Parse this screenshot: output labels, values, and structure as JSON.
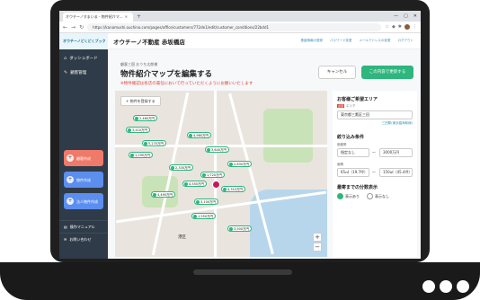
{
  "browser": {
    "tab_title": "オウチーノすまいる - 物件紹介マ...",
    "new_tab": "+",
    "url": "https://kanamushi.ouchino.com/pages/office/customers/772de1/edit/customer_conditions/22bdd1",
    "window_controls": [
      "—",
      "▢",
      "✕"
    ]
  },
  "sidebar": {
    "logo": "オウチーノどくどくブック",
    "items": [
      {
        "label": "ダッシュボード",
        "icon": "home-icon"
      },
      {
        "label": "顧客管理",
        "icon": "wrench-icon"
      }
    ],
    "buttons": [
      {
        "label": "顧客作成",
        "color": "#f07a6a"
      },
      {
        "label": "物件作成",
        "color": "#5c8ef0"
      },
      {
        "label": "法人物件作成",
        "color": "#5c8ef0"
      }
    ],
    "bottom_items": [
      {
        "label": "操作マニュアル"
      },
      {
        "label": "お問い合わせ"
      }
    ]
  },
  "header": {
    "company": "オウチーノ不動産 赤坂橋店",
    "links": [
      "基盤情報の登録",
      "パスワード変更",
      "メールアドレスの変更",
      "ログアウト"
    ]
  },
  "page": {
    "breadcrumb": "顧客三国 おうち太郎様",
    "title": "物件紹介マップを編集する",
    "notice": "※物件確認は各店の責任において行っていただくようにお願いいたします",
    "cancel_label": "キャンセル",
    "save_label": "この内容で更新する"
  },
  "map": {
    "add_property_label": "+ 物件を登録する",
    "area_label": "港区",
    "pins": [
      "2,480万円",
      "3,410万円",
      "4,980万円",
      "5,270万円",
      "3,640万円",
      "1,290万円",
      "2,830万円",
      "2,330万円",
      "1,720万円",
      "4,550万円",
      "4,310万円",
      "4,490万円",
      "3,100万円",
      "1,550万円",
      "3,500万円"
    ],
    "zoom_in": "+",
    "zoom_out": "−"
  },
  "panel": {
    "area_heading": "お客様ご希望エリア",
    "area_required": "必須",
    "area_sub": "エリア",
    "area_value": "東京都三鷹区三田",
    "area_link": "三田駅(東京臨海新線)",
    "filter_heading": "絞り込み条件",
    "price_label": "価格帯",
    "price_min": "指定なし",
    "price_max": "3000万円",
    "area_size_label": "面積",
    "size_min": "65㎡（19.7坪）",
    "size_max": "150㎡（45.4坪）",
    "tilde": "〜",
    "walk_heading": "最寄までの分数表示",
    "walk_options": [
      "表示あり",
      "表示なし"
    ]
  }
}
